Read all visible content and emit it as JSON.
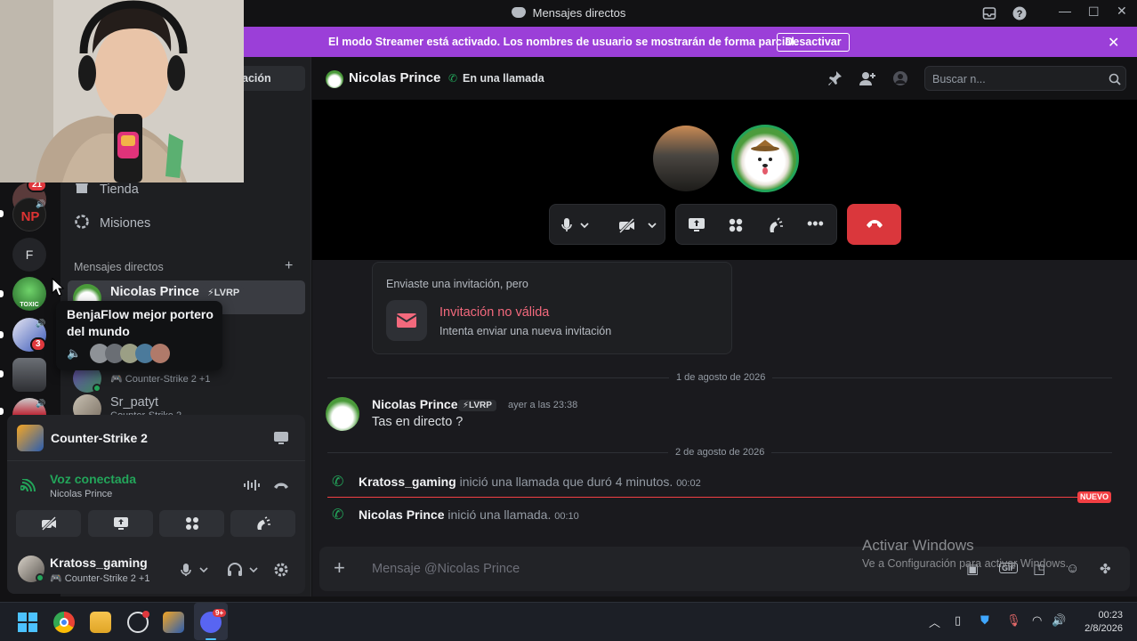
{
  "window": {
    "title": "Mensajes directos"
  },
  "banner": {
    "text": "El modo Streamer está activado. Los nombres de usuario se mostrarán de forma parcial.",
    "button": "Desactivar"
  },
  "rail": {
    "badge_top": "21",
    "badge_mid": "3",
    "f_label": "F",
    "toxic_label": "TOXIC"
  },
  "sidebar": {
    "partial_tab": "ación",
    "nav": [
      {
        "label": "Tienda",
        "icon": "shop-icon"
      },
      {
        "label": "Misiones",
        "icon": "quests-icon"
      }
    ],
    "dm_header": "Mensajes directos",
    "dms": [
      {
        "name": "Nicolas Prince",
        "tag": "⚡LVRP",
        "sub": ""
      },
      {
        "name": "",
        "tag": "",
        "sub": "Counter-Strike 2 +1"
      },
      {
        "name": "Sr_patyt",
        "tag": "",
        "sub": "Counter-Strike 2"
      }
    ],
    "tooltip": "BenjaFlow mejor portero del mundo"
  },
  "panel": {
    "activity": "Counter-Strike 2",
    "voice_status": "Voz conectada",
    "voice_channel": "Nicolas Prince",
    "user_name": "Kratoss_gaming",
    "user_sub": "Counter-Strike 2 +1"
  },
  "main": {
    "header_name": "Nicolas Prince",
    "header_status": "En una llamada",
    "search_placeholder": "Buscar n...",
    "invite": {
      "heading": "Enviaste una invitación, pero",
      "title": "Invitación no válida",
      "subtitle": "Intenta enviar una nueva invitación"
    },
    "date1": "1 de agosto de 2026",
    "message": {
      "author": "Nicolas Prince",
      "tag": "⚡LVRP",
      "time": "ayer a las 23:38",
      "text": "Tas en directo ?"
    },
    "date2": "2 de agosto de 2026",
    "sys1": {
      "author": "Kratoss_gaming",
      "text": "inició una llamada que duró 4 minutos.",
      "time": "00:02"
    },
    "new_badge": "NUEVO",
    "sys2": {
      "author": "Nicolas Prince",
      "text": "inició una llamada.",
      "time": "00:10"
    },
    "composer_placeholder": "Mensaje @Nicolas Prince"
  },
  "watermark": {
    "title": "Activar Windows",
    "sub": "Ve a Configuración para activar Windows."
  },
  "taskbar": {
    "time": "00:23",
    "date": "2/8/2026",
    "discord_badge": "9+"
  },
  "colors": {
    "accent": "#9b3fd8",
    "danger": "#da373c",
    "online": "#23a55a",
    "new": "#f23f43"
  }
}
